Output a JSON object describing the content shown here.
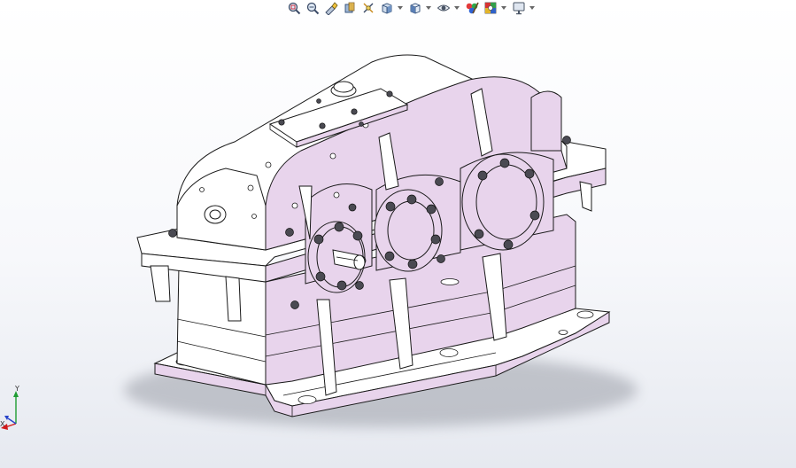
{
  "toolbar": {
    "items": [
      {
        "icon": "zoom-to-fit-icon"
      },
      {
        "icon": "zoom-to-area-icon"
      },
      {
        "icon": "previous-view-icon"
      },
      {
        "icon": "section-view-icon"
      },
      {
        "icon": "dynamic-annotation-views-icon"
      },
      {
        "icon": "view-orientation-icon",
        "dropdown": true
      },
      {
        "icon": "display-style-icon",
        "dropdown": true
      },
      {
        "icon": "hide-show-items-icon",
        "dropdown": true
      },
      {
        "icon": "edit-appearance-icon"
      },
      {
        "icon": "apply-scene-icon",
        "dropdown": true
      },
      {
        "icon": "view-settings-icon",
        "dropdown": true
      }
    ]
  },
  "triad": {
    "y_label": "Y",
    "x_label": "X",
    "colors": {
      "x": "#d11a1a",
      "y": "#1f9d33",
      "z": "#2541c9"
    }
  },
  "model": {
    "appearance_color": "#e8d4ec",
    "edge_color": "#1a1a1a",
    "bolt_color": "#4a4a52"
  }
}
